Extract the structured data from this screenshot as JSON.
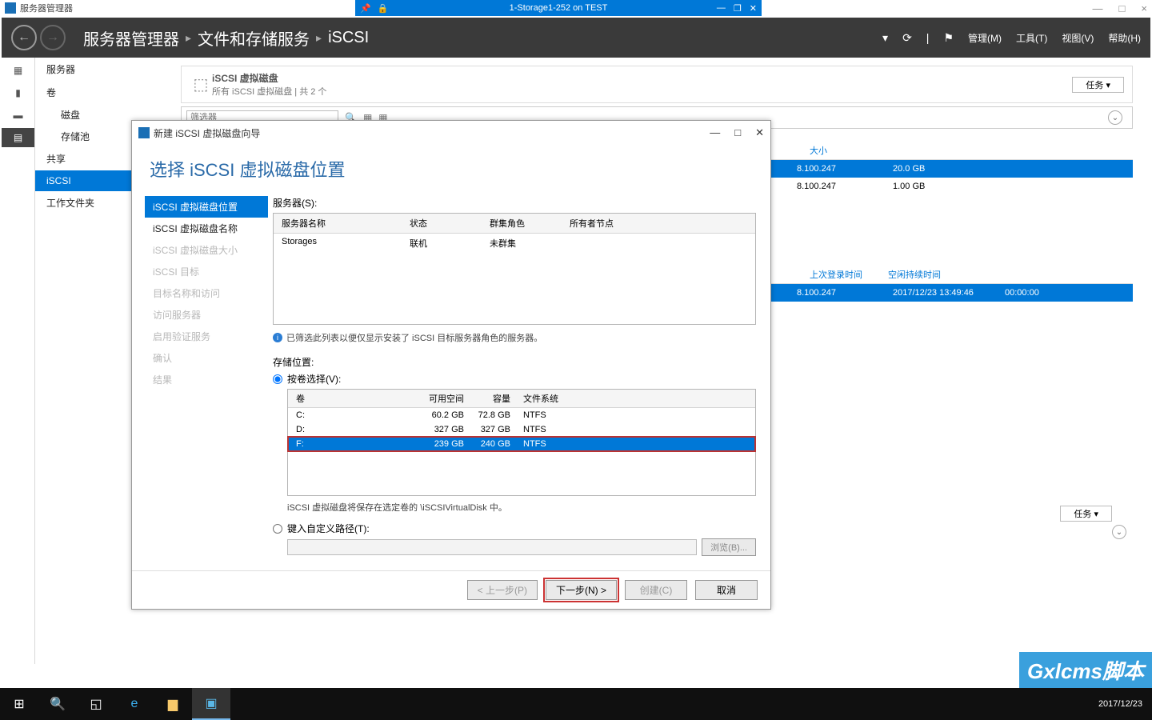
{
  "outer": {
    "title": "服务器管理器",
    "min": "—",
    "max": "□",
    "close": "×"
  },
  "remote": {
    "title": "1-Storage1-252 on TEST",
    "pin": "📌",
    "lock": "🔒",
    "min": "—",
    "restore": "❐",
    "close": "✕"
  },
  "sm": {
    "crumb1": "服务器管理器",
    "crumb2": "文件和存储服务",
    "crumb3": "iSCSI",
    "menu": {
      "manage": "管理(M)",
      "tools": "工具(T)",
      "view": "视图(V)",
      "help": "帮助(H)"
    }
  },
  "nav": {
    "items": [
      "服务器",
      "卷"
    ],
    "subs": [
      "磁盘",
      "存储池"
    ],
    "items2": [
      "共享",
      "iSCSI",
      "工作文件夹"
    ],
    "selected": "iSCSI"
  },
  "panel": {
    "title": "iSCSI 虚拟磁盘",
    "subtitle": "所有 iSCSI 虚拟磁盘 | 共 2 个",
    "task": "任务",
    "search_ph": "筛选器"
  },
  "grid": {
    "cols": [
      "",
      "",
      "大小"
    ],
    "rows": [
      {
        "a": "8.100.247",
        "b": "20.0 GB",
        "sel": true
      },
      {
        "a": "8.100.247",
        "b": "1.00 GB",
        "sel": false
      }
    ],
    "cols2": [
      "上次登录时间",
      "空闲持续时间"
    ],
    "row2": {
      "a": "8.100.247",
      "b": "2017/12/23 13:49:46",
      "c": "00:00:00"
    }
  },
  "wizard": {
    "title": "新建 iSCSI 虚拟磁盘向导",
    "heading": "选择 iSCSI 虚拟磁盘位置",
    "steps": [
      {
        "label": "iSCSI 虚拟磁盘位置",
        "state": "sel"
      },
      {
        "label": "iSCSI 虚拟磁盘名称",
        "state": ""
      },
      {
        "label": "iSCSI 虚拟磁盘大小",
        "state": "dis"
      },
      {
        "label": "iSCSI 目标",
        "state": "dis"
      },
      {
        "label": "目标名称和访问",
        "state": "dis"
      },
      {
        "label": "访问服务器",
        "state": "dis"
      },
      {
        "label": "启用验证服务",
        "state": "dis"
      },
      {
        "label": "确认",
        "state": "dis"
      },
      {
        "label": "结果",
        "state": "dis"
      }
    ],
    "server_label": "服务器(S):",
    "server_cols": [
      "服务器名称",
      "状态",
      "群集角色",
      "所有者节点"
    ],
    "server_row": [
      "Storages",
      "联机",
      "未群集",
      ""
    ],
    "filter_note": "已筛选此列表以便仅显示安装了 iSCSI 目标服务器角色的服务器。",
    "storage_label": "存储位置:",
    "radio_volume": "按卷选择(V):",
    "vol_cols": [
      "卷",
      "可用空间",
      "容量",
      "文件系统"
    ],
    "vol_rows": [
      {
        "v": "C:",
        "free": "60.2 GB",
        "cap": "72.8 GB",
        "fs": "NTFS",
        "sel": false
      },
      {
        "v": "D:",
        "free": "327 GB",
        "cap": "327 GB",
        "fs": "NTFS",
        "sel": false
      },
      {
        "v": "F:",
        "free": "239 GB",
        "cap": "240 GB",
        "fs": "NTFS",
        "sel": true
      }
    ],
    "path_note": "iSCSI 虚拟磁盘将保存在选定卷的 \\iSCSIVirtualDisk 中。",
    "radio_custom": "键入自定义路径(T):",
    "browse": "浏览(B)...",
    "buttons": {
      "prev": "< 上一步(P)",
      "next": "下一步(N) >",
      "create": "创建(C)",
      "cancel": "取消"
    }
  },
  "taskbar": {
    "date": "2017/12/23"
  },
  "watermark": "Gxlcms脚本"
}
